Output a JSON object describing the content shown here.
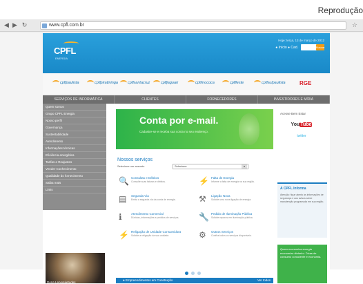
{
  "caption": "Reprodução",
  "browser": {
    "url": "www.cpfl.com.br",
    "back_icon": "back-arrow-icon",
    "forward_icon": "forward-arrow-icon",
    "reload_icon": "reload-icon",
    "star_icon": "star-icon"
  },
  "header": {
    "logo_text": "CPFL",
    "logo_sub": "ENERGIA",
    "date": "Hoje: terça, 13 de março de 2012",
    "login_text": "● Início  ● Cad.",
    "search_go": "Buscar"
  },
  "brands": [
    "cpflpaulista",
    "cpflpiratininga",
    "cpflsantacruz",
    "cpfljaguari",
    "cpflmococa",
    "cpflleste",
    "cpflsulpaulista",
    "RGE"
  ],
  "nav": [
    "SERVIÇOS DE INFORMÁTICA",
    "CLIENTES",
    "FORNECEDORES",
    "INVESTIDORES E MÍDIA"
  ],
  "sidebar": [
    "Quem somos",
    "Grupo CPFL Energia",
    "Nosso perfil",
    "Governança",
    "Sustentabilidade",
    "Atendimento",
    "Informações técnicas",
    "Eficiência energética",
    "Tarifas e Reajustes",
    "Vender Conhecimento",
    "Qualidade do fornecimento",
    "Saiba mais",
    "Links"
  ],
  "photo_caption": "Dona Lenoquietudes",
  "banner": {
    "title": "Conta por e-mail.",
    "subtitle": "Cadastre-se e receba sua conta no seu endereço."
  },
  "services": {
    "title": "Nossos serviços",
    "select_label": "Selecione um assunto",
    "select_value": "Selecione",
    "items": [
      {
        "name": "Consultas e Débitos",
        "desc": "Consulte suas faturas e débitos.",
        "icon": "search-document-icon"
      },
      {
        "name": "Segunda Via",
        "desc": "Emita a segunda via da conta de energia.",
        "icon": "document-icon"
      },
      {
        "name": "Atendimento Comercial",
        "desc": "Dúvidas, informações e pedidos de serviços.",
        "icon": "info-icon"
      },
      {
        "name": "Religação de Unidade Consumidora",
        "desc": "Solicite a religação da sua unidade.",
        "icon": "plug-icon"
      },
      {
        "name": "Falta de Energia",
        "desc": "Informe a falta de energia na sua região.",
        "icon": "lightning-icon"
      },
      {
        "name": "Ligação Nova",
        "desc": "Solicite uma nova ligação de energia.",
        "icon": "new-connection-icon"
      },
      {
        "name": "Pedido de Iluminação Pública",
        "desc": "Solicite reparos em iluminação pública.",
        "icon": "wrench-icon"
      },
      {
        "name": "Outros Serviços",
        "desc": "Confira todos os serviços disponíveis.",
        "icon": "tools-icon"
      }
    ]
  },
  "carousel": {
    "count": 3,
    "active": 1
  },
  "bottom_bar": {
    "text": "● Empreendimentos em Construção",
    "more": "Ver todos"
  },
  "right": {
    "follow_text": "Acesse Bem Estar",
    "youtube": "You",
    "youtube_tube": "Tube",
    "twitter": "twitter",
    "panel_title": "A CPFL Informa",
    "panel_text": "Atenção: fique atento às informações de segurança e aos avisos sobre manutenção programada em sua região.",
    "green_text": "Quem economiza energia economiza dinheiro. Dicas de consumo consciente e economia."
  },
  "colors": {
    "accent": "#1a7cc1",
    "green": "#3fb24a",
    "nav": "#6e6e6e"
  }
}
